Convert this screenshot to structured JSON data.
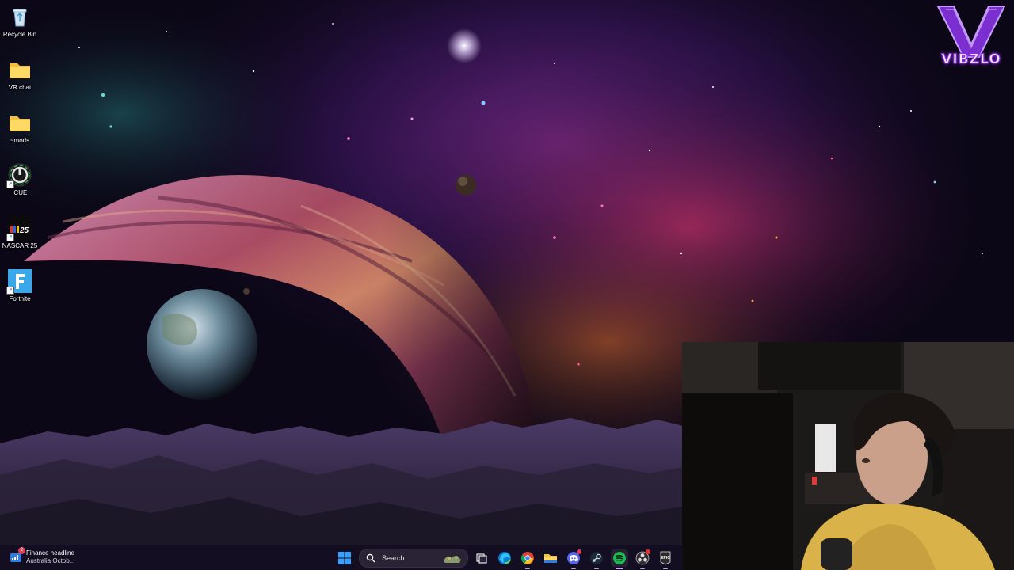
{
  "desktop": {
    "icons": [
      {
        "label": "Recycle Bin",
        "icon": "recycle-bin-icon"
      },
      {
        "label": "VR chat",
        "icon": "folder-icon"
      },
      {
        "label": "~mods",
        "icon": "folder-icon"
      },
      {
        "label": "iCUE",
        "icon": "icue-icon"
      },
      {
        "label": "NASCAR 25",
        "icon": "nascar-25-icon"
      },
      {
        "label": "Fortnite",
        "icon": "fortnite-icon"
      }
    ]
  },
  "overlay": {
    "logo_text": "VIBZLO",
    "logo_letter": "V",
    "logo_color": "#9b3df2"
  },
  "taskbar": {
    "widget": {
      "title": "Finance headline",
      "subtitle": "Australia Octob...",
      "badge": "2"
    },
    "search": {
      "placeholder": "Search"
    },
    "apps": [
      "start-icon",
      "task-view-icon",
      "edge-icon",
      "chrome-icon",
      "file-explorer-icon",
      "discord-icon",
      "steam-icon",
      "spotify-icon",
      "obs-icon",
      "epic-games-icon"
    ]
  },
  "colors": {
    "taskbar_bg": "#140e22",
    "accent": "#9b3df2",
    "spotify": "#1db954"
  }
}
